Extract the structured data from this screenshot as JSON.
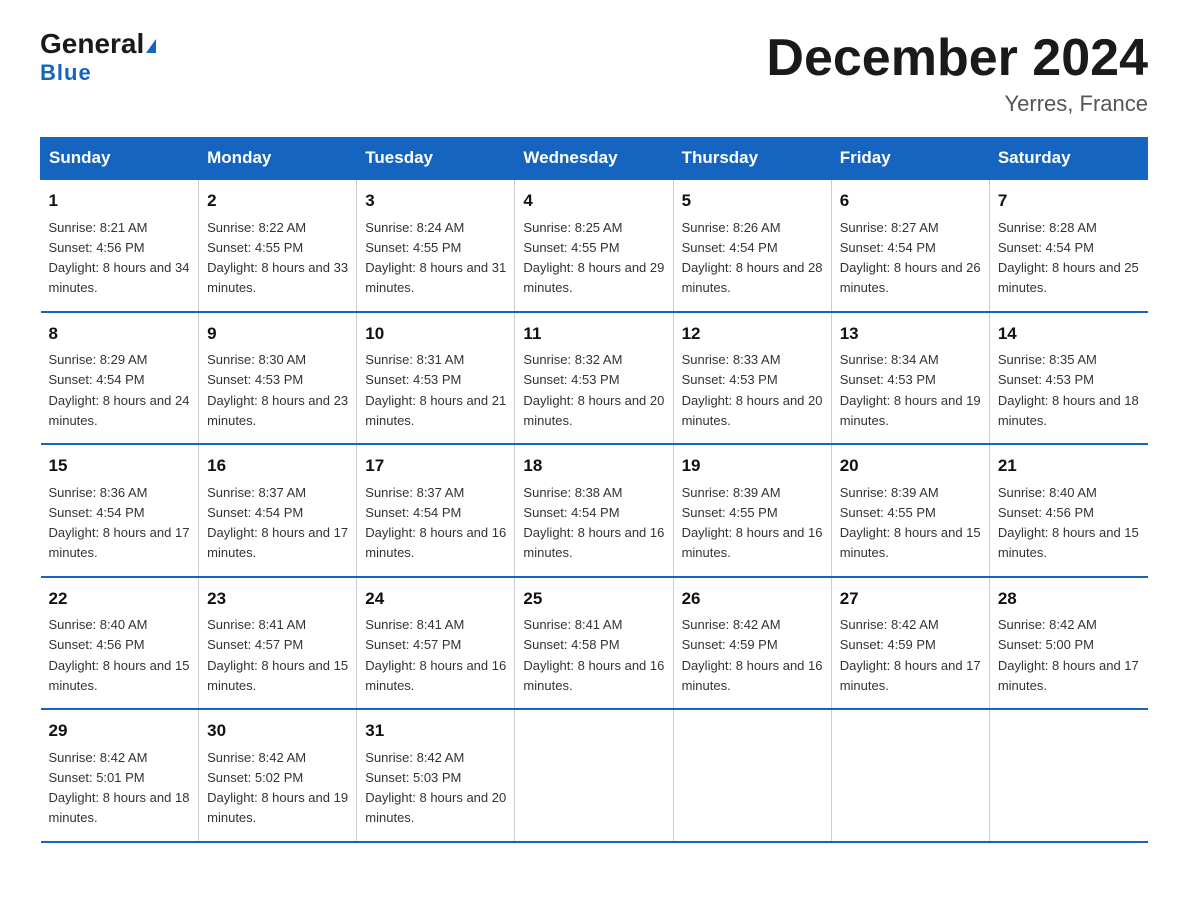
{
  "header": {
    "logo_general": "General",
    "logo_blue": "Blue",
    "month_title": "December 2024",
    "location": "Yerres, France"
  },
  "days": [
    "Sunday",
    "Monday",
    "Tuesday",
    "Wednesday",
    "Thursday",
    "Friday",
    "Saturday"
  ],
  "weeks": [
    [
      {
        "num": "1",
        "sunrise": "8:21 AM",
        "sunset": "4:56 PM",
        "daylight": "8 hours and 34 minutes."
      },
      {
        "num": "2",
        "sunrise": "8:22 AM",
        "sunset": "4:55 PM",
        "daylight": "8 hours and 33 minutes."
      },
      {
        "num": "3",
        "sunrise": "8:24 AM",
        "sunset": "4:55 PM",
        "daylight": "8 hours and 31 minutes."
      },
      {
        "num": "4",
        "sunrise": "8:25 AM",
        "sunset": "4:55 PM",
        "daylight": "8 hours and 29 minutes."
      },
      {
        "num": "5",
        "sunrise": "8:26 AM",
        "sunset": "4:54 PM",
        "daylight": "8 hours and 28 minutes."
      },
      {
        "num": "6",
        "sunrise": "8:27 AM",
        "sunset": "4:54 PM",
        "daylight": "8 hours and 26 minutes."
      },
      {
        "num": "7",
        "sunrise": "8:28 AM",
        "sunset": "4:54 PM",
        "daylight": "8 hours and 25 minutes."
      }
    ],
    [
      {
        "num": "8",
        "sunrise": "8:29 AM",
        "sunset": "4:54 PM",
        "daylight": "8 hours and 24 minutes."
      },
      {
        "num": "9",
        "sunrise": "8:30 AM",
        "sunset": "4:53 PM",
        "daylight": "8 hours and 23 minutes."
      },
      {
        "num": "10",
        "sunrise": "8:31 AM",
        "sunset": "4:53 PM",
        "daylight": "8 hours and 21 minutes."
      },
      {
        "num": "11",
        "sunrise": "8:32 AM",
        "sunset": "4:53 PM",
        "daylight": "8 hours and 20 minutes."
      },
      {
        "num": "12",
        "sunrise": "8:33 AM",
        "sunset": "4:53 PM",
        "daylight": "8 hours and 20 minutes."
      },
      {
        "num": "13",
        "sunrise": "8:34 AM",
        "sunset": "4:53 PM",
        "daylight": "8 hours and 19 minutes."
      },
      {
        "num": "14",
        "sunrise": "8:35 AM",
        "sunset": "4:53 PM",
        "daylight": "8 hours and 18 minutes."
      }
    ],
    [
      {
        "num": "15",
        "sunrise": "8:36 AM",
        "sunset": "4:54 PM",
        "daylight": "8 hours and 17 minutes."
      },
      {
        "num": "16",
        "sunrise": "8:37 AM",
        "sunset": "4:54 PM",
        "daylight": "8 hours and 17 minutes."
      },
      {
        "num": "17",
        "sunrise": "8:37 AM",
        "sunset": "4:54 PM",
        "daylight": "8 hours and 16 minutes."
      },
      {
        "num": "18",
        "sunrise": "8:38 AM",
        "sunset": "4:54 PM",
        "daylight": "8 hours and 16 minutes."
      },
      {
        "num": "19",
        "sunrise": "8:39 AM",
        "sunset": "4:55 PM",
        "daylight": "8 hours and 16 minutes."
      },
      {
        "num": "20",
        "sunrise": "8:39 AM",
        "sunset": "4:55 PM",
        "daylight": "8 hours and 15 minutes."
      },
      {
        "num": "21",
        "sunrise": "8:40 AM",
        "sunset": "4:56 PM",
        "daylight": "8 hours and 15 minutes."
      }
    ],
    [
      {
        "num": "22",
        "sunrise": "8:40 AM",
        "sunset": "4:56 PM",
        "daylight": "8 hours and 15 minutes."
      },
      {
        "num": "23",
        "sunrise": "8:41 AM",
        "sunset": "4:57 PM",
        "daylight": "8 hours and 15 minutes."
      },
      {
        "num": "24",
        "sunrise": "8:41 AM",
        "sunset": "4:57 PM",
        "daylight": "8 hours and 16 minutes."
      },
      {
        "num": "25",
        "sunrise": "8:41 AM",
        "sunset": "4:58 PM",
        "daylight": "8 hours and 16 minutes."
      },
      {
        "num": "26",
        "sunrise": "8:42 AM",
        "sunset": "4:59 PM",
        "daylight": "8 hours and 16 minutes."
      },
      {
        "num": "27",
        "sunrise": "8:42 AM",
        "sunset": "4:59 PM",
        "daylight": "8 hours and 17 minutes."
      },
      {
        "num": "28",
        "sunrise": "8:42 AM",
        "sunset": "5:00 PM",
        "daylight": "8 hours and 17 minutes."
      }
    ],
    [
      {
        "num": "29",
        "sunrise": "8:42 AM",
        "sunset": "5:01 PM",
        "daylight": "8 hours and 18 minutes."
      },
      {
        "num": "30",
        "sunrise": "8:42 AM",
        "sunset": "5:02 PM",
        "daylight": "8 hours and 19 minutes."
      },
      {
        "num": "31",
        "sunrise": "8:42 AM",
        "sunset": "5:03 PM",
        "daylight": "8 hours and 20 minutes."
      },
      null,
      null,
      null,
      null
    ]
  ]
}
